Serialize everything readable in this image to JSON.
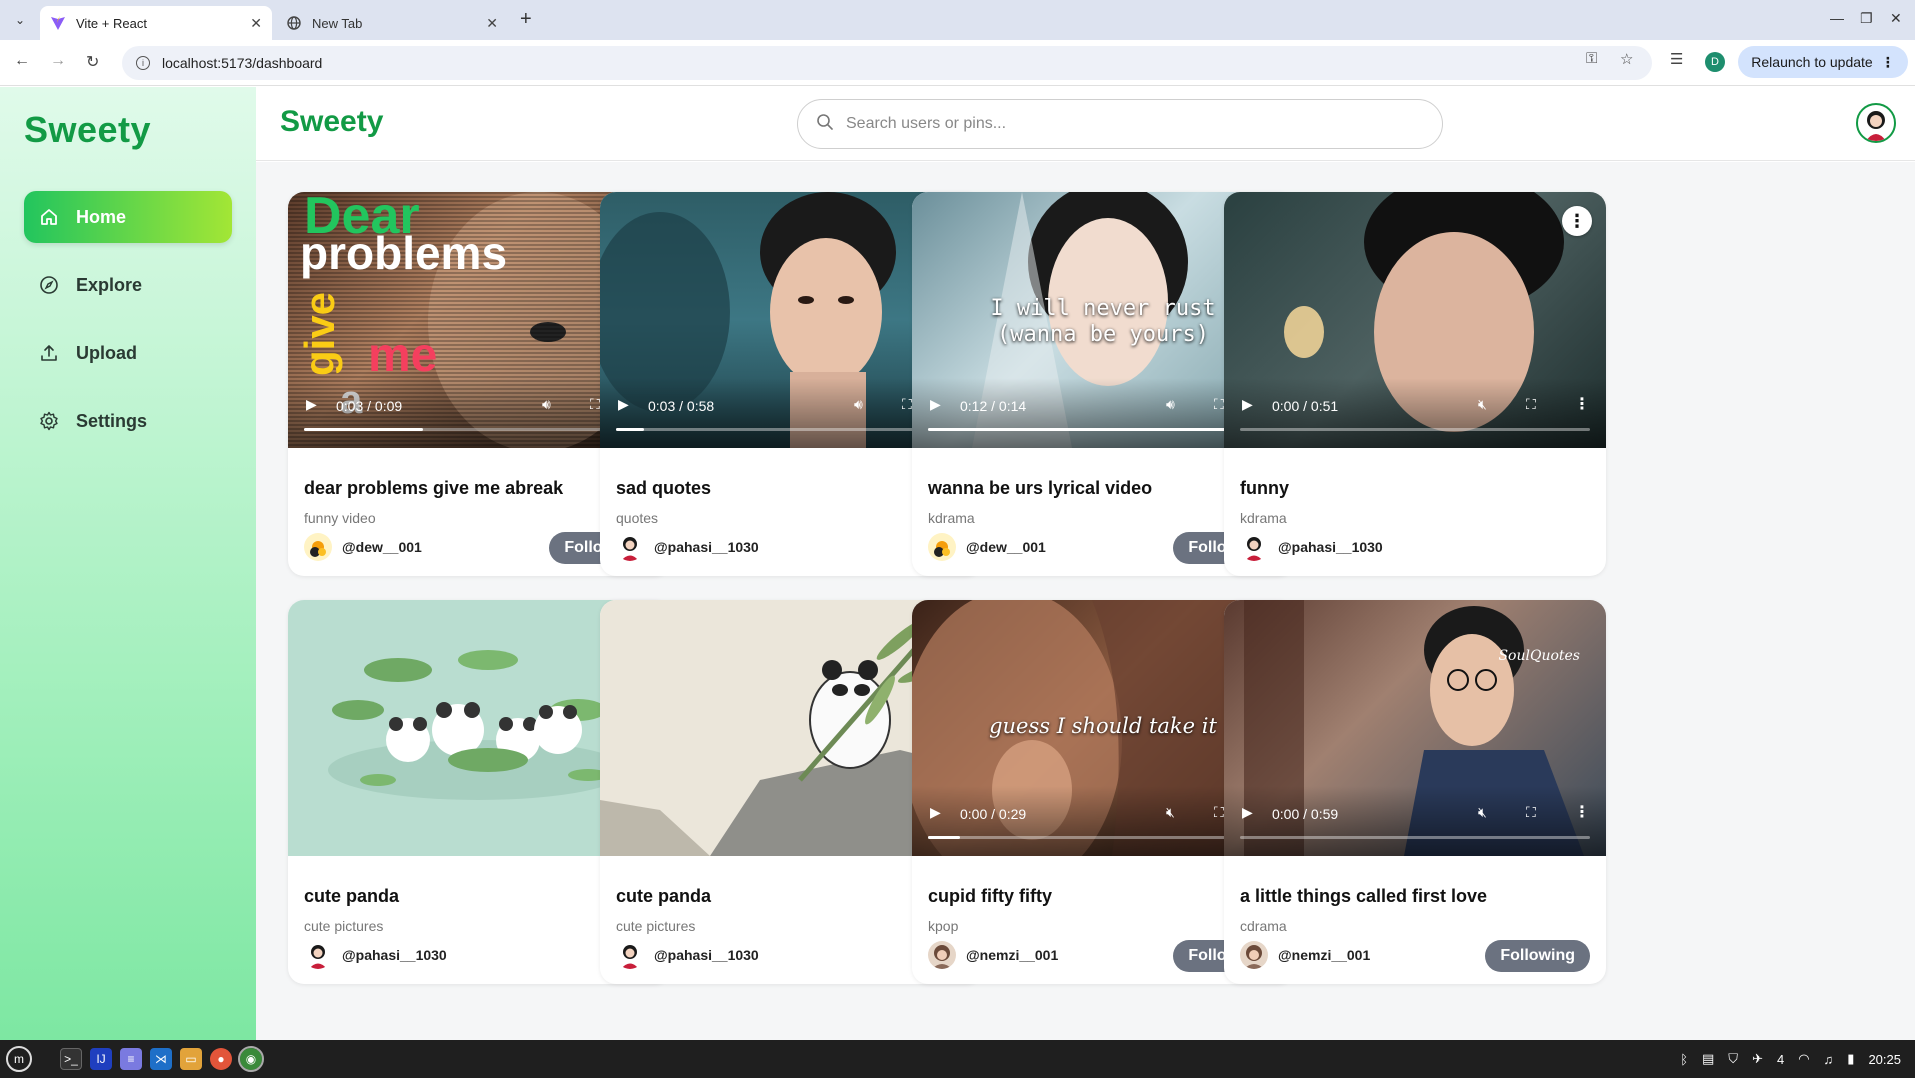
{
  "browser": {
    "tabs": [
      {
        "title": "Vite + React",
        "active": true
      },
      {
        "title": "New Tab",
        "active": false
      }
    ],
    "url": "localhost:5173/dashboard",
    "profile_initial": "D",
    "relaunch_label": "Relaunch to update"
  },
  "app": {
    "brand": "Sweety",
    "header_brand": "Sweety",
    "search_placeholder": "Search users or pins...",
    "nav": [
      {
        "label": "Home",
        "icon": "home-icon",
        "active": true
      },
      {
        "label": "Explore",
        "icon": "compass-icon",
        "active": false
      },
      {
        "label": "Upload",
        "icon": "upload-icon",
        "active": false
      },
      {
        "label": "Settings",
        "icon": "gear-icon",
        "active": false
      }
    ]
  },
  "pins": [
    {
      "title": "dear problems give me abreak",
      "category": "funny video",
      "user": "@dew__001",
      "following": true,
      "follow_label": "Following",
      "type": "video",
      "time": "0:03 / 0:09",
      "progress": 0.34,
      "muted": false,
      "overlay": [
        "Dear",
        "problems",
        "give",
        "me",
        "a"
      ]
    },
    {
      "title": "sad quotes",
      "category": "quotes",
      "user": "@pahasi__1030",
      "following": false,
      "type": "video",
      "time": "0:03 / 0:58",
      "progress": 0.08,
      "muted": false,
      "overlay": []
    },
    {
      "title": "wanna be urs lyrical video",
      "category": "kdrama",
      "user": "@dew__001",
      "following": true,
      "follow_label": "Following",
      "type": "video",
      "time": "0:12 / 0:14",
      "progress": 0.86,
      "muted": false,
      "overlay": [
        "I will never rust",
        "(wanna be yours)"
      ]
    },
    {
      "title": "funny",
      "category": "kdrama",
      "user": "@pahasi__1030",
      "following": false,
      "type": "video",
      "time": "0:00 / 0:51",
      "progress": 0.0,
      "muted": true,
      "overlay": []
    },
    {
      "title": "cute panda",
      "category": "cute pictures",
      "user": "@pahasi__1030",
      "following": false,
      "type": "image",
      "overlay": []
    },
    {
      "title": "cute panda",
      "category": "cute pictures",
      "user": "@pahasi__1030",
      "following": false,
      "type": "image",
      "overlay": []
    },
    {
      "title": "cupid fifty fifty",
      "category": "kpop",
      "user": "@nemzi__001",
      "following": true,
      "follow_label": "Following",
      "type": "video",
      "time": "0:00 / 0:29",
      "progress": 0.09,
      "muted": true,
      "overlay": [
        "guess I should take it"
      ]
    },
    {
      "title": "a little things called first love",
      "category": "cdrama",
      "user": "@nemzi__001",
      "following": true,
      "follow_label": "Following",
      "type": "video",
      "time": "0:00 / 0:59",
      "progress": 0.0,
      "muted": true,
      "overlay": [
        "SoulQuotes"
      ]
    }
  ],
  "taskbar": {
    "clock": "20:25",
    "workspace": "4"
  }
}
